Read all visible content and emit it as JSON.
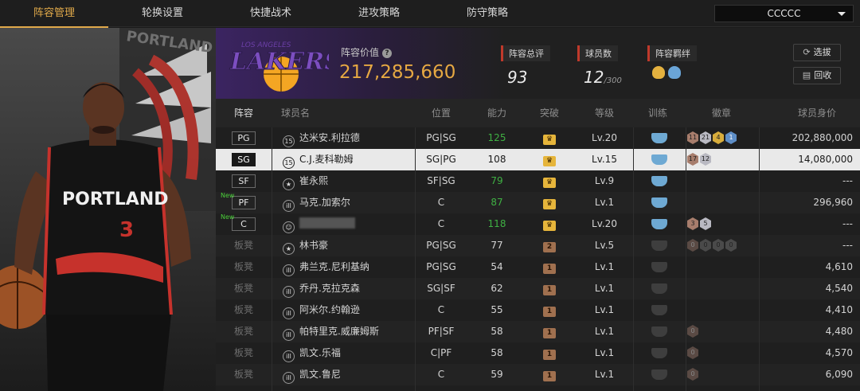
{
  "tabs": [
    "阵容管理",
    "轮换设置",
    "快捷战术",
    "进攻策略",
    "防守策略"
  ],
  "account_dropdown": "CCCCC",
  "team": {
    "logo_text": "LAKERS",
    "logo_sub": "LOS ANGELES",
    "value_label": "阵容价值",
    "value": "217,285,660",
    "rating_label": "阵容总评",
    "rating": "93",
    "count_label": "球员数",
    "count": "12",
    "count_max": "/300",
    "bond_label": "阵容羁绊"
  },
  "buttons": {
    "select": "选拔",
    "recycle": "回收"
  },
  "columns": [
    "阵容",
    "球员名",
    "位置",
    "能力",
    "突破",
    "等级",
    "训练",
    "徽章",
    "球员身价"
  ],
  "player_art": {
    "team_text": "PORTLAND",
    "jersey_number": "3"
  },
  "rows": [
    {
      "slot": "PG",
      "num": "15",
      "name": "达米安.利拉德",
      "pos": "PG|SG",
      "ability": "125",
      "ability_color": "green",
      "break": "gold",
      "level": "Lv.20",
      "train": "on",
      "badges": [
        [
          "11",
          "brown"
        ],
        [
          "21",
          "silver"
        ],
        [
          "4",
          "gold"
        ],
        [
          "1",
          "blue"
        ]
      ],
      "value": "202,880,000"
    },
    {
      "slot": "SG",
      "num": "15",
      "name": "C.J.麦科勒姆",
      "pos": "SG|PG",
      "ability": "108",
      "ability_color": "normal",
      "break": "gold",
      "level": "Lv.15",
      "train": "on",
      "badges": [
        [
          "17",
          "brown"
        ],
        [
          "12",
          "silver"
        ]
      ],
      "value": "14,080,000",
      "selected": true
    },
    {
      "slot": "SF",
      "num": "★",
      "name": "崔永熙",
      "pos": "SF|SG",
      "ability": "79",
      "ability_color": "green",
      "break": "gold",
      "level": "Lv.9",
      "train": "on",
      "badges": [],
      "value": "---"
    },
    {
      "slot": "PF",
      "new": "New",
      "num": "ill",
      "name": "马克.加索尔",
      "pos": "C",
      "ability": "87",
      "ability_color": "green",
      "break": "gold",
      "level": "Lv.1",
      "train": "on",
      "badges": [],
      "value": "296,960"
    },
    {
      "slot": "C",
      "new": "New",
      "num": "☺",
      "name": "",
      "pos": "C",
      "ability": "118",
      "ability_color": "green",
      "break": "gold",
      "level": "Lv.20",
      "train": "on",
      "badges": [
        [
          "3",
          "brown"
        ],
        [
          "5",
          "silver"
        ]
      ],
      "value": "---"
    },
    {
      "slot": "板凳",
      "num": "★",
      "name": "林书豪",
      "pos": "PG|SG",
      "ability": "77",
      "ability_color": "normal",
      "break": "2",
      "level": "Lv.5",
      "train": "off",
      "badges": [
        [
          "0",
          "darkbrown"
        ],
        [
          "0",
          "dark"
        ],
        [
          "0",
          "dark"
        ],
        [
          "0",
          "dark"
        ]
      ],
      "value": "---"
    },
    {
      "slot": "板凳",
      "num": "ill",
      "name": "弗兰克.尼利基纳",
      "pos": "PG|SG",
      "ability": "54",
      "ability_color": "normal",
      "break": "1",
      "level": "Lv.1",
      "train": "off",
      "badges": [],
      "value": "4,610"
    },
    {
      "slot": "板凳",
      "num": "ill",
      "name": "乔丹.克拉克森",
      "pos": "SG|SF",
      "ability": "62",
      "ability_color": "normal",
      "break": "1",
      "level": "Lv.1",
      "train": "off",
      "badges": [],
      "value": "4,540"
    },
    {
      "slot": "板凳",
      "num": "ill",
      "name": "阿米尔.约翰逊",
      "pos": "C",
      "ability": "55",
      "ability_color": "normal",
      "break": "1",
      "level": "Lv.1",
      "train": "off",
      "badges": [],
      "value": "4,410"
    },
    {
      "slot": "板凳",
      "num": "ill",
      "name": "帕特里克.威廉姆斯",
      "pos": "PF|SF",
      "ability": "58",
      "ability_color": "normal",
      "break": "1",
      "level": "Lv.1",
      "train": "off",
      "badges": [
        [
          "0",
          "darkbrown"
        ]
      ],
      "value": "4,480"
    },
    {
      "slot": "板凳",
      "num": "ill",
      "name": "凯文.乐福",
      "pos": "C|PF",
      "ability": "58",
      "ability_color": "normal",
      "break": "1",
      "level": "Lv.1",
      "train": "off",
      "badges": [
        [
          "0",
          "darkbrown"
        ]
      ],
      "value": "4,570"
    },
    {
      "slot": "板凳",
      "num": "ill",
      "name": "凯文.鲁尼",
      "pos": "C",
      "ability": "59",
      "ability_color": "normal",
      "break": "1",
      "level": "Lv.1",
      "train": "off",
      "badges": [
        [
          "0",
          "darkbrown"
        ]
      ],
      "value": "6,090"
    }
  ]
}
